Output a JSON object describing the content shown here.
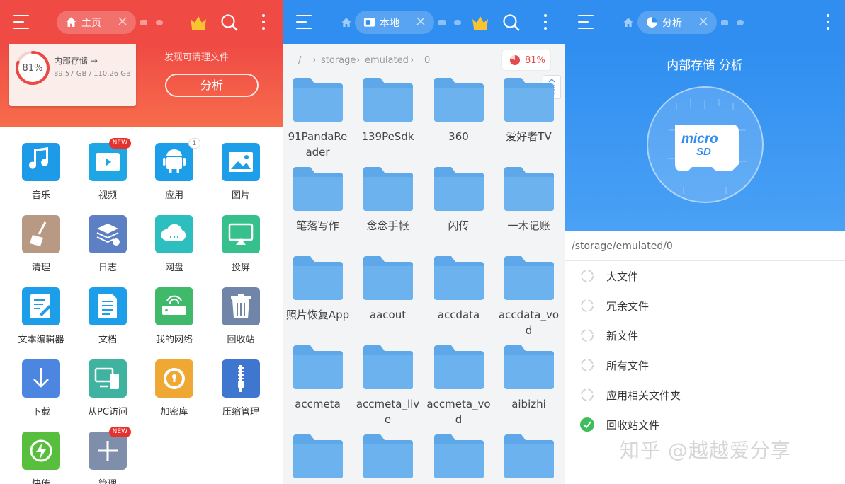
{
  "colors": {
    "red": "#ef4a44",
    "blue": "#2f8ef0",
    "folder": "#5ea8ea",
    "check": "#3fbd5c"
  },
  "home": {
    "tab_label": "主页",
    "storage_title": "内部存储 →",
    "storage_percent": "81%",
    "storage_used_fraction": 0.81,
    "storage_size": "89.57 GB / 110.26 GB",
    "cleanup_hint": "发现可清理文件",
    "analyze_label": "分析",
    "apps": [
      {
        "label": "音乐",
        "icon": "music-icon",
        "color": "#1e9be8",
        "badge": ""
      },
      {
        "label": "视频",
        "icon": "video-icon",
        "color": "#1ea7e4",
        "badge": "NEW"
      },
      {
        "label": "应用",
        "icon": "android-icon",
        "color": "#1d9ee8",
        "badge": "1"
      },
      {
        "label": "图片",
        "icon": "image-icon",
        "color": "#1d9ee8",
        "badge": ""
      },
      {
        "label": "清理",
        "icon": "broom-icon",
        "color": "#b89a84",
        "badge": ""
      },
      {
        "label": "日志",
        "icon": "log-icon",
        "color": "#5d7fc3",
        "badge": ""
      },
      {
        "label": "网盘",
        "icon": "cloud-icon",
        "color": "#2dbfbf",
        "badge": ""
      },
      {
        "label": "投屏",
        "icon": "cast-icon",
        "color": "#35c08c",
        "badge": ""
      },
      {
        "label": "文本编辑器",
        "icon": "text-editor-icon",
        "color": "#1d9ee8",
        "badge": ""
      },
      {
        "label": "文档",
        "icon": "document-icon",
        "color": "#1d9ee8",
        "badge": ""
      },
      {
        "label": "我的网络",
        "icon": "router-icon",
        "color": "#41b96b",
        "badge": ""
      },
      {
        "label": "回收站",
        "icon": "trash-icon",
        "color": "#7185a8",
        "badge": ""
      },
      {
        "label": "下载",
        "icon": "download-icon",
        "color": "#4d86e0",
        "badge": ""
      },
      {
        "label": "从PC访问",
        "icon": "pc-access-icon",
        "color": "#3fb3a0",
        "badge": ""
      },
      {
        "label": "加密库",
        "icon": "vault-icon",
        "color": "#f0a835",
        "badge": ""
      },
      {
        "label": "压缩管理",
        "icon": "zip-icon",
        "color": "#3f76cf",
        "badge": ""
      },
      {
        "label": "快传",
        "icon": "quick-transfer-icon",
        "color": "#58be3d",
        "badge": ""
      },
      {
        "label": "管理",
        "icon": "plus-icon",
        "color": "#7f8eaa",
        "badge": "NEW"
      }
    ]
  },
  "local": {
    "tab_label": "本地",
    "crumbs": [
      "/",
      "storage",
      "emulated",
      "0"
    ],
    "usage_percent": "81%",
    "usage_fraction": 0.81,
    "folders": [
      "91PandaReader",
      "139PeSdk",
      "360",
      "爱好者TV",
      "笔落写作",
      "念念手帐",
      "闪传",
      "一木记账",
      "照片恢复App",
      "aacout",
      "accdata",
      "accdata_vod",
      "accmeta",
      "accmeta_live",
      "accmeta_vod",
      "aibizhi",
      "",
      "",
      "",
      ""
    ]
  },
  "analysis": {
    "tab_label": "分析",
    "title": "内部存储 分析",
    "path": "/storage/emulated/0",
    "options": [
      {
        "label": "大文件",
        "done": false
      },
      {
        "label": "冗余文件",
        "done": false
      },
      {
        "label": "新文件",
        "done": false
      },
      {
        "label": "所有文件",
        "done": false
      },
      {
        "label": "应用相关文件夹",
        "done": false
      },
      {
        "label": "回收站文件",
        "done": true
      }
    ]
  },
  "watermark": "知乎 @越越爱分享"
}
